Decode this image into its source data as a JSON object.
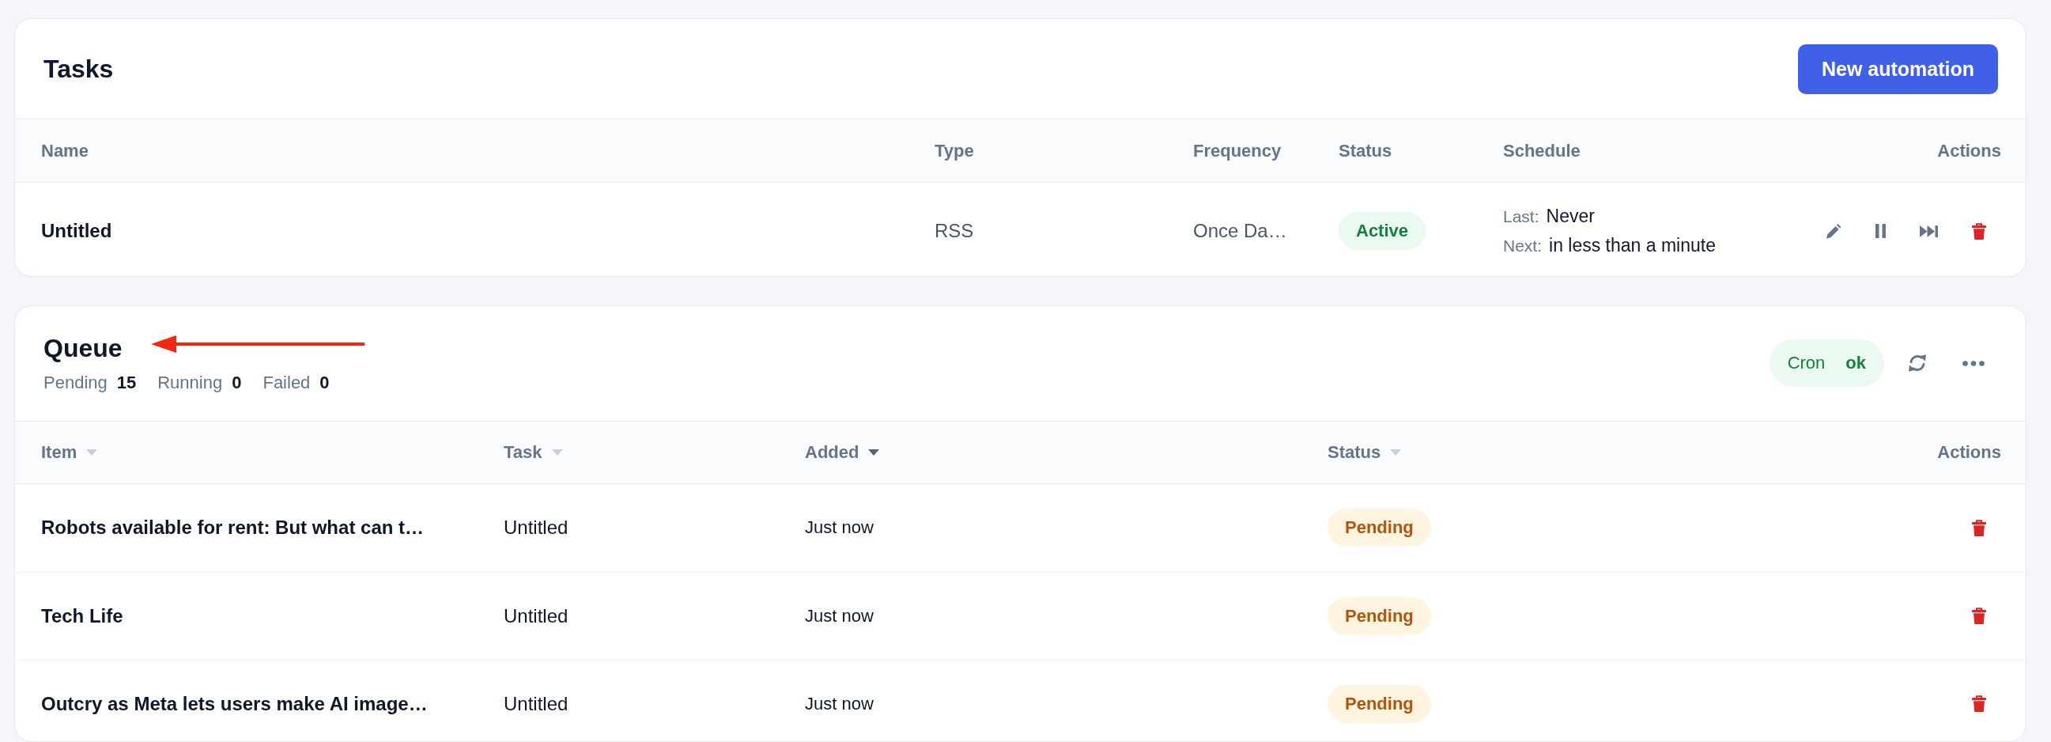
{
  "tasks": {
    "title": "Tasks",
    "new_button": "New automation",
    "columns": [
      "Name",
      "Type",
      "Frequency",
      "Status",
      "Schedule",
      "Actions"
    ],
    "rows": [
      {
        "name": "Untitled",
        "type": "RSS",
        "frequency": "Once Da…",
        "status": {
          "label": "Active",
          "kind": "success"
        },
        "schedule": {
          "last_label": "Last:",
          "last": "Never",
          "next_label": "Next:",
          "next": "in less than a minute"
        },
        "actions": [
          {
            "kind": "edit"
          },
          {
            "kind": "pause"
          },
          {
            "kind": "skip"
          },
          {
            "kind": "delete"
          }
        ]
      }
    ]
  },
  "queue": {
    "title": "Queue",
    "stats": [
      {
        "label": "Pending",
        "value": "15"
      },
      {
        "label": "Running",
        "value": "0"
      },
      {
        "label": "Failed",
        "value": "0"
      }
    ],
    "cron": {
      "label": "Cron",
      "value": "ok",
      "kind": "success"
    },
    "columns": [
      {
        "label": "Item",
        "sorted": false
      },
      {
        "label": "Task",
        "sorted": false
      },
      {
        "label": "Added",
        "sorted": true
      },
      {
        "label": "Status",
        "sorted": false
      },
      {
        "label": "Actions"
      }
    ],
    "rows": [
      {
        "item": "Robots available for rent: But what can t…",
        "task": "Untitled",
        "added": "Just now",
        "status": {
          "label": "Pending",
          "kind": "warning"
        },
        "actions": [
          {
            "kind": "delete"
          }
        ]
      },
      {
        "item": "Tech Life",
        "task": "Untitled",
        "added": "Just now",
        "status": {
          "label": "Pending",
          "kind": "warning"
        },
        "actions": [
          {
            "kind": "delete"
          }
        ]
      },
      {
        "item": "Outcry as Meta lets users make AI image…",
        "task": "Untitled",
        "added": "Just now",
        "status": {
          "label": "Pending",
          "kind": "warning"
        },
        "actions": [
          {
            "kind": "delete"
          }
        ]
      }
    ]
  }
}
